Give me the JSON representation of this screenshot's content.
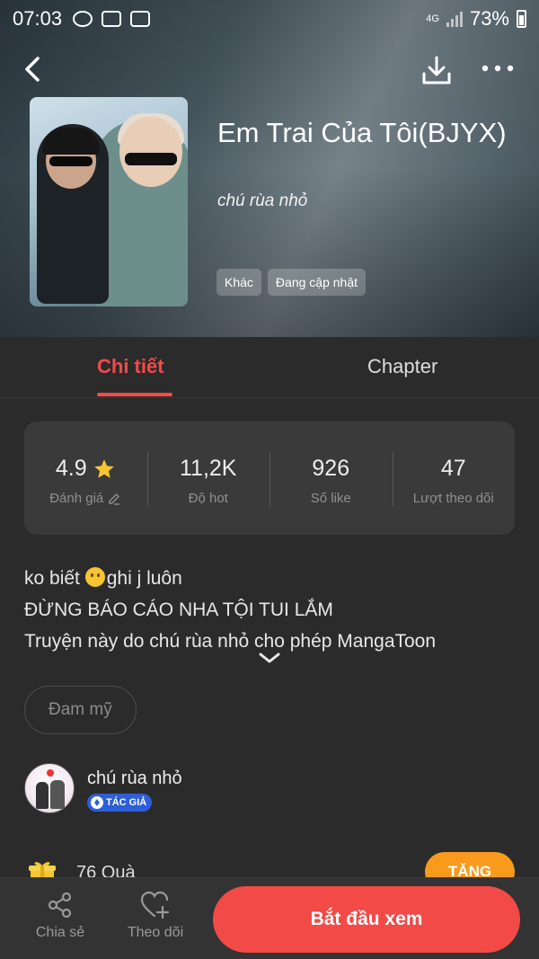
{
  "status_bar": {
    "time": "07:03",
    "network": "4G",
    "battery": "73%"
  },
  "book": {
    "title": "Em Trai Của Tôi(BJYX)",
    "author": "chú rùa nhỏ",
    "tags": [
      "Khác",
      "Đang cập nhật"
    ]
  },
  "tabs": {
    "detail": "Chi tiết",
    "chapter": "Chapter"
  },
  "stats": [
    {
      "value": "4.9",
      "label": "Đánh giá"
    },
    {
      "value": "11,2K",
      "label": "Độ hot"
    },
    {
      "value": "926",
      "label": "Số like"
    },
    {
      "value": "47",
      "label": "Lượt theo dõi"
    }
  ],
  "description": {
    "line1_prefix": "ko biết ",
    "line1_suffix": "ghi j luôn",
    "line2": "ĐỪNG BÁO CÁO NHA TỘI TUI LẮM",
    "line3": "Truyện này do chú rùa nhỏ cho phép MangaToon"
  },
  "genre": "Đam mỹ",
  "author_section": {
    "name": "chú rùa nhỏ",
    "badge": "TÁC GIẢ"
  },
  "gift": {
    "label": "76 Quà",
    "button": "TẶNG"
  },
  "bottom_bar": {
    "share": "Chia sẻ",
    "follow": "Theo dõi",
    "start": "Bắt đầu xem"
  },
  "colors": {
    "accent": "#f34a4a",
    "start_button": "#f24a47",
    "give_button": "#f89a1c",
    "badge": "#2c5fd8",
    "star": "#f6c531"
  }
}
